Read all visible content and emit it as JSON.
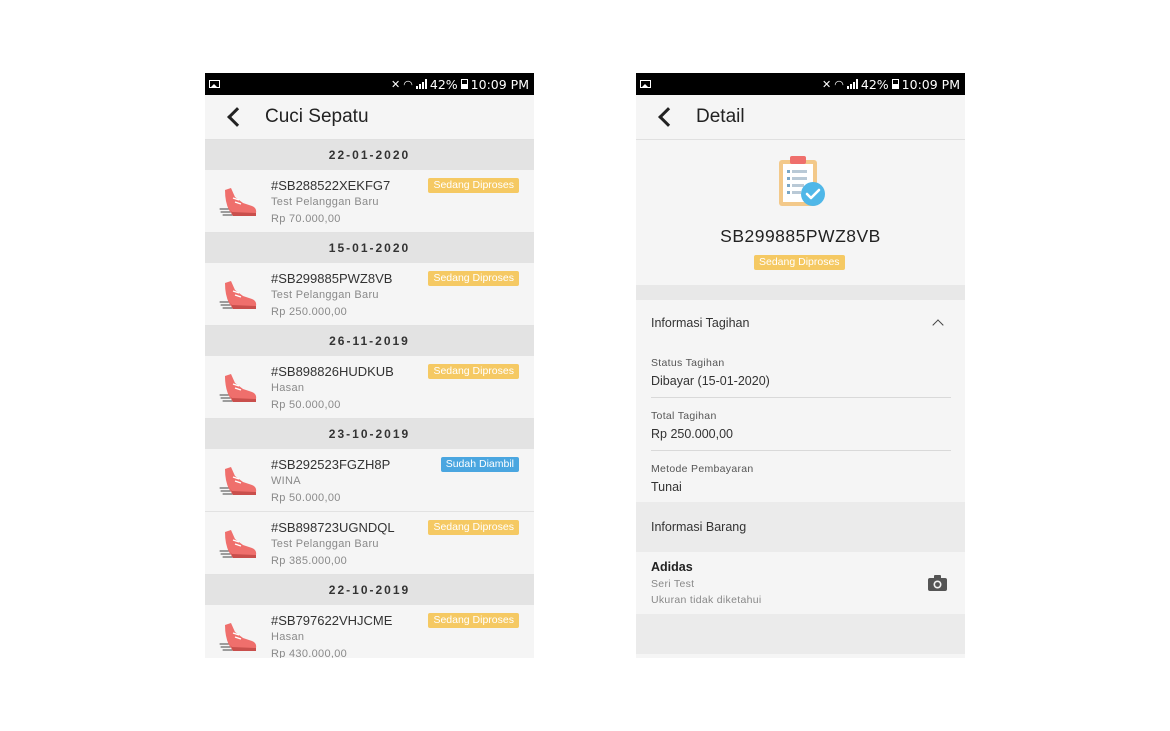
{
  "status_bar": {
    "left": {
      "status": "10:09 PM",
      "battery": "42%"
    },
    "right": {
      "status": "10:09 PM",
      "battery": "42%"
    }
  },
  "list_screen": {
    "title": "Cuci Sepatu",
    "groups": [
      {
        "date": "22-01-2020",
        "orders": [
          {
            "code": "#SB288522XEKFG7",
            "customer": "Test Pelanggan Baru",
            "price": "Rp 70.000,00",
            "status": "Sedang Diproses",
            "status_color": "#f5c963"
          }
        ]
      },
      {
        "date": "15-01-2020",
        "orders": [
          {
            "code": "#SB299885PWZ8VB",
            "customer": "Test Pelanggan Baru",
            "price": "Rp 250.000,00",
            "status": "Sedang Diproses",
            "status_color": "#f5c963"
          }
        ]
      },
      {
        "date": "26-11-2019",
        "orders": [
          {
            "code": "#SB898826HUDKUB",
            "customer": "Hasan",
            "price": "Rp 50.000,00",
            "status": "Sedang Diproses",
            "status_color": "#f5c963"
          }
        ]
      },
      {
        "date": "23-10-2019",
        "orders": [
          {
            "code": "#SB292523FGZH8P",
            "customer": "WINA",
            "price": "Rp 50.000,00",
            "status": "Sudah Diambil",
            "status_color": "#4aa6e0"
          },
          {
            "code": "#SB898723UGNDQL",
            "customer": "Test Pelanggan Baru",
            "price": "Rp 385.000,00",
            "status": "Sedang Diproses",
            "status_color": "#f5c963"
          }
        ]
      },
      {
        "date": "22-10-2019",
        "orders": [
          {
            "code": "#SB797622VHJCME",
            "customer": "Hasan",
            "price": "Rp 430.000,00",
            "status": "Sedang Diproses",
            "status_color": "#f5c963"
          }
        ]
      }
    ]
  },
  "detail_screen": {
    "title": "Detail",
    "code": "SB299885PWZ8VB",
    "status": "Sedang Diproses",
    "billing": {
      "heading": "Informasi Tagihan",
      "fields": [
        {
          "label": "Status Tagihan",
          "value": "Dibayar (15-01-2020)"
        },
        {
          "label": "Total Tagihan",
          "value": "Rp 250.000,00"
        },
        {
          "label": "Metode Pembayaran",
          "value": "Tunai"
        }
      ]
    },
    "items": {
      "heading": "Informasi Barang",
      "entries": [
        {
          "name": "Adidas",
          "series": "Seri Test",
          "size": "Ukuran tidak diketahui"
        }
      ]
    }
  },
  "icons": [
    "back-arrow-icon",
    "shoe-icon",
    "clipboard-check-icon",
    "camera-icon",
    "chevron-up-icon"
  ],
  "colors": {
    "processing": "#f5c963",
    "picked_up": "#4aa6e0",
    "shoe": "#ef6f6c"
  }
}
